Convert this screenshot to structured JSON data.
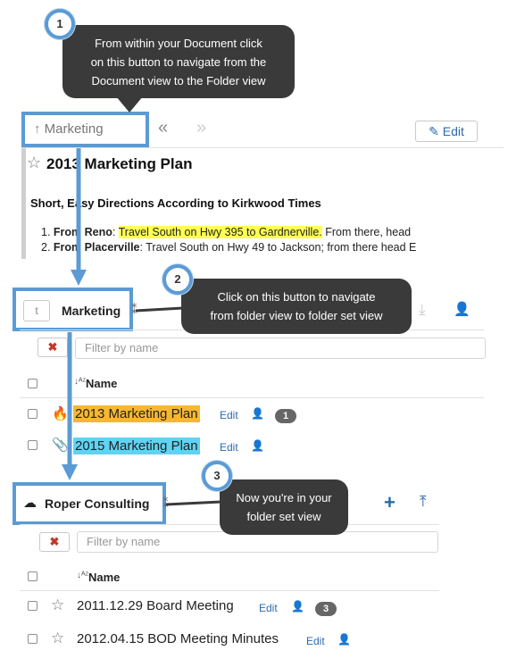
{
  "callouts": [
    {
      "number": "1",
      "text_lines": [
        "From within your Document click",
        "on this button to navigate from the",
        "Document view to the Folder view"
      ]
    },
    {
      "number": "2",
      "text_lines": [
        "Click on this button to navigate",
        "from folder view to folder set view"
      ]
    },
    {
      "number": "3",
      "text_lines": [
        "Now you're in your",
        "folder set view"
      ]
    }
  ],
  "document_view": {
    "back_label": "Marketing",
    "prev_arrows": "«",
    "next_arrows": "»",
    "edit_label": "Edit",
    "title": "2013 Marketing Plan",
    "heading": "Short, Easy Directions According to Kirkwood Times",
    "list": [
      {
        "num": "1.",
        "bold": "From Reno",
        "sep": ":",
        "highlight": "Travel South on Hwy 395 to Gardnerville.",
        "rest": " From there, head"
      },
      {
        "num": "2.",
        "bold": "From Placerville",
        "sep": ":",
        "highlight": "",
        "rest": " Travel South on Hwy 49 to Jackson; from there head E"
      }
    ]
  },
  "folder_view": {
    "up_glyph": "t",
    "title": "Marketing",
    "filter_placeholder": "Filter by name",
    "clear_glyph": "✖",
    "column_name": "Name",
    "sort_glyph": "↓ᴬᶻ",
    "rows": [
      {
        "name": "2013 Marketing Plan",
        "edit": "Edit",
        "badge": "1",
        "highlight": "#f7b731",
        "icon": "fire-icon"
      },
      {
        "name": "2015 Marketing Plan",
        "edit": "Edit",
        "badge": "",
        "highlight": "#5fd3f3",
        "icon": "paperclip-icon"
      }
    ]
  },
  "folder_set_view": {
    "title": "Roper Consulting",
    "filter_placeholder": "Filter by name",
    "clear_glyph": "✖",
    "column_name": "Name",
    "sort_glyph": "↓ᴬᶻ",
    "rows": [
      {
        "name": "2011.12.29 Board Meeting",
        "edit": "Edit",
        "badge": "3"
      },
      {
        "name": "2012.04.15 BOD Meeting Minutes",
        "edit": "Edit",
        "badge": ""
      }
    ]
  },
  "colors": {
    "accent_blue": "#5b9bd5",
    "link": "#2b6aad",
    "callout_bg": "#3a3a3a"
  }
}
